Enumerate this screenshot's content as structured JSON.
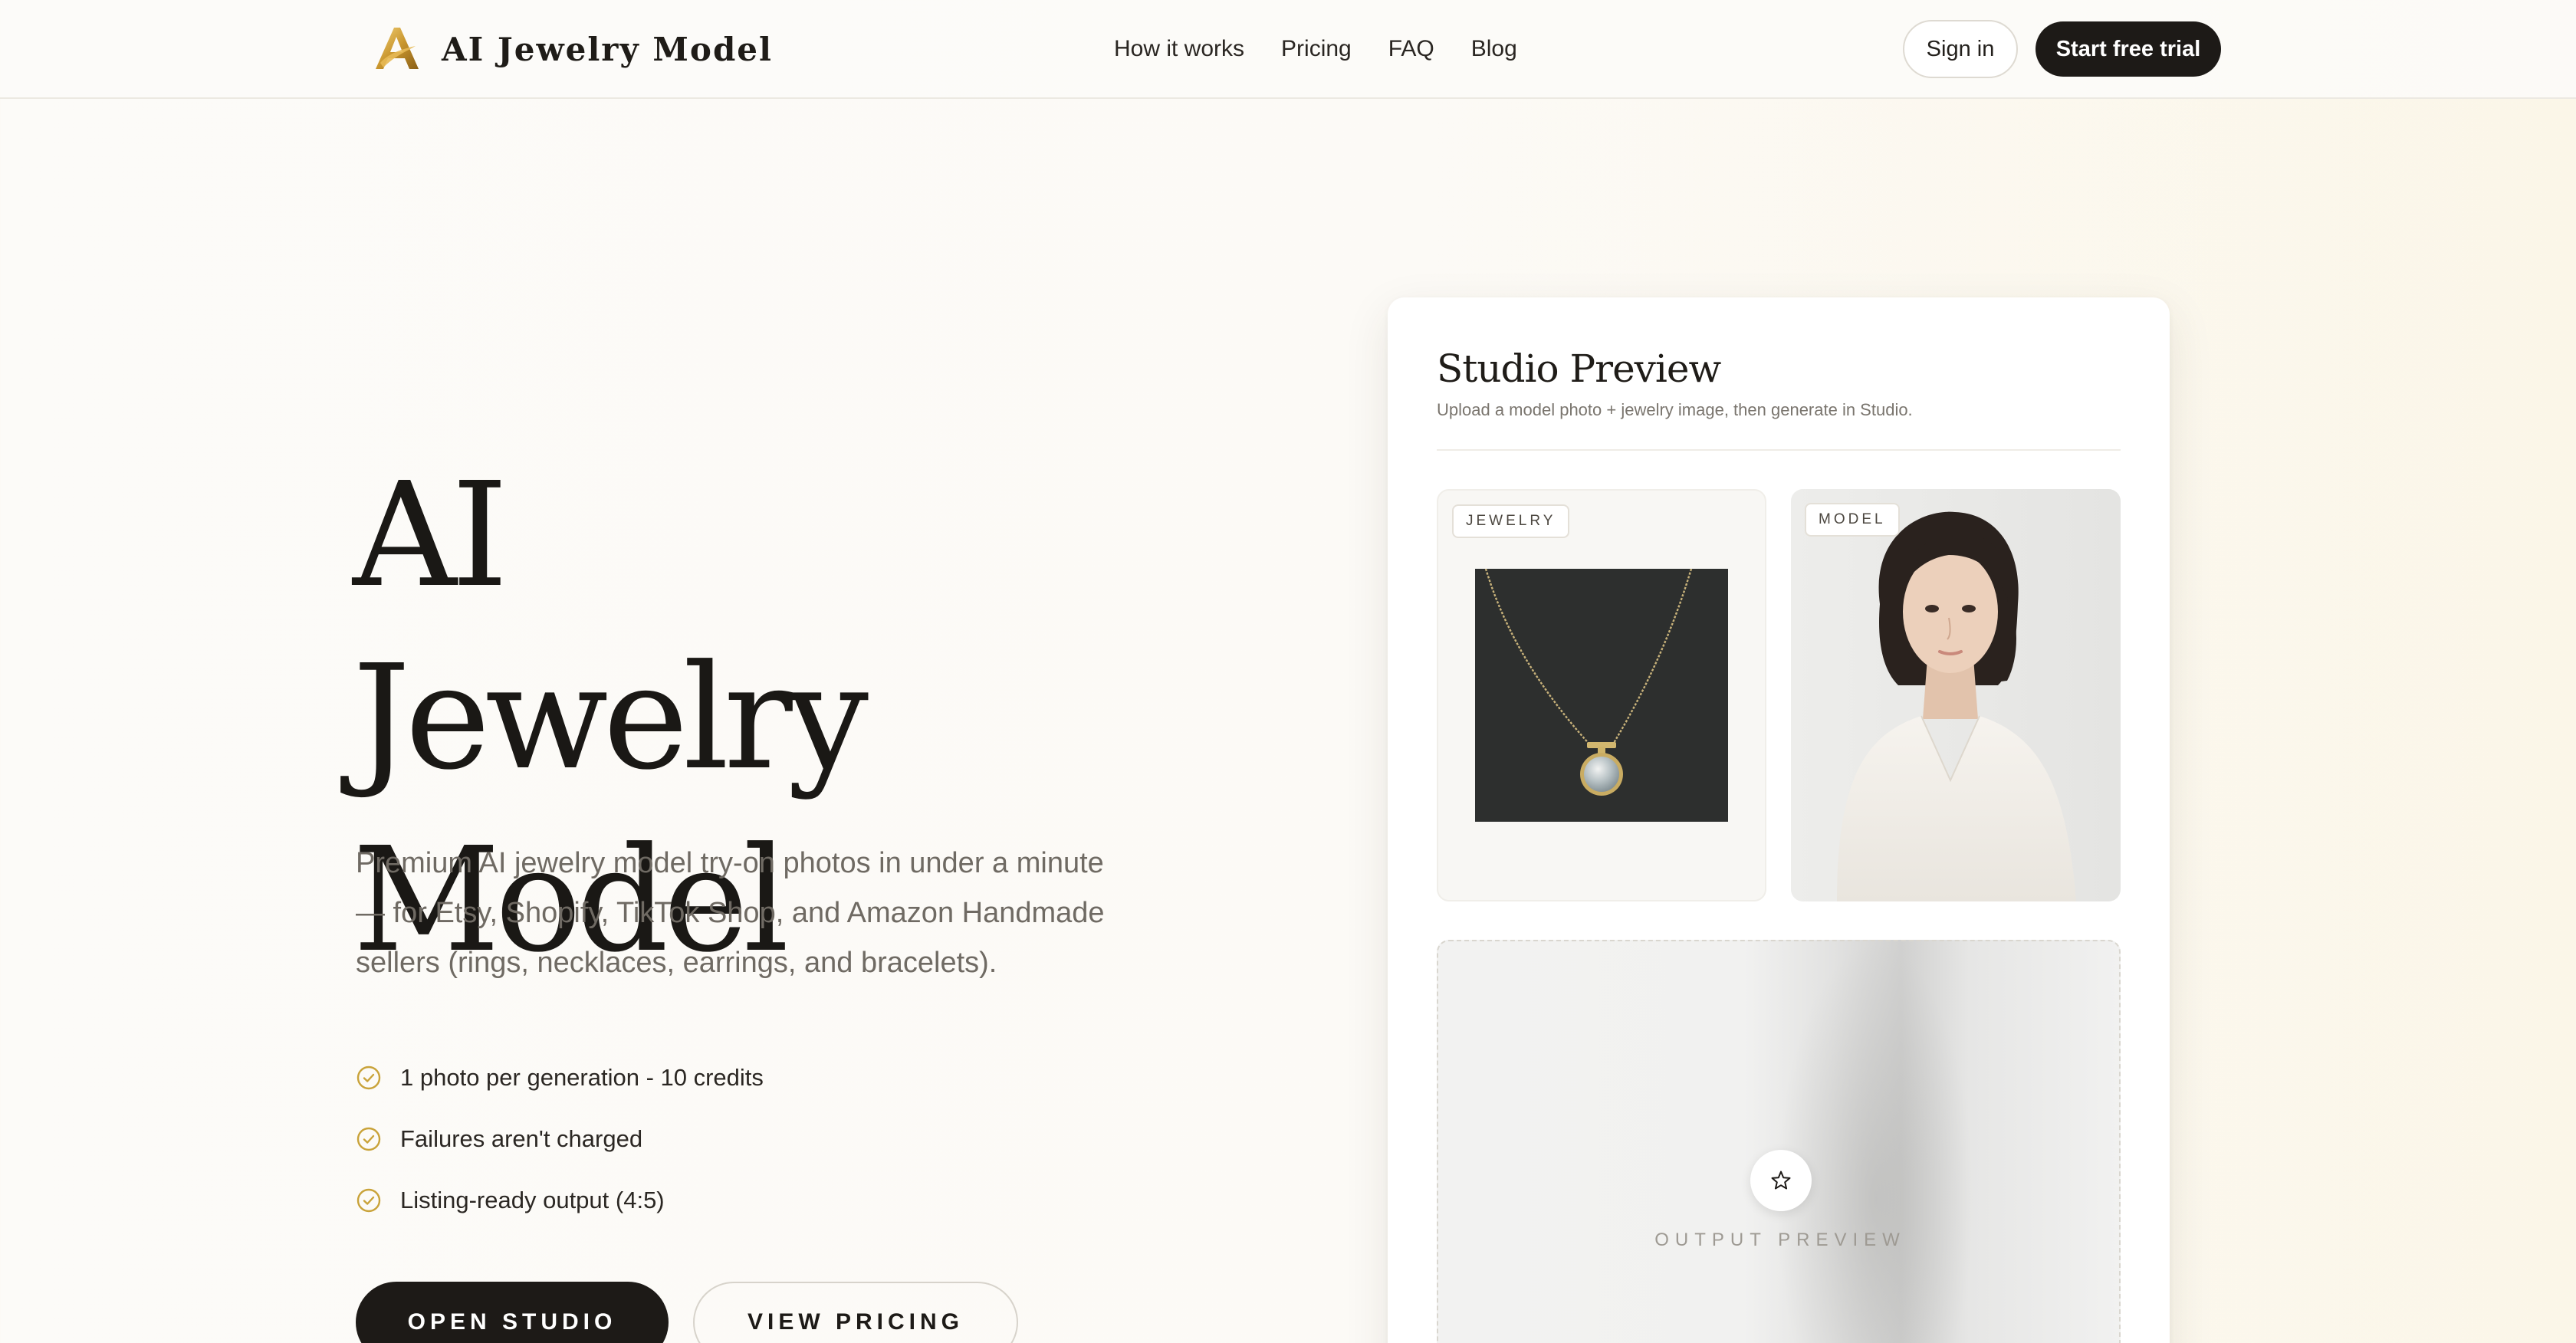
{
  "header": {
    "brand_name": "AI Jewelry Model",
    "logo_icon": "gold-letter-a-logo",
    "nav": [
      {
        "label": "How it works"
      },
      {
        "label": "Pricing"
      },
      {
        "label": "FAQ"
      },
      {
        "label": "Blog"
      }
    ],
    "sign_in_label": "Sign in",
    "trial_label": "Start free trial"
  },
  "hero": {
    "title_line1": "AI Jewelry",
    "title_line2": "Model",
    "subtitle": "Premium AI jewelry model try-on photos in under a minute — for Etsy, Shopify, TikTok Shop, and Amazon Handmade sellers (rings, necklaces, earrings, and bracelets).",
    "features": [
      {
        "text": "1 photo per generation - 10 credits"
      },
      {
        "text": "Failures aren't charged"
      },
      {
        "text": "Listing-ready output (4:5)"
      }
    ],
    "feature_icon": "check-circle-icon",
    "open_studio_label": "OPEN STUDIO",
    "view_pricing_label": "VIEW PRICING"
  },
  "studio": {
    "title": "Studio Preview",
    "subtitle": "Upload a model photo + jewelry image, then generate in Studio.",
    "jewelry_tag": "JEWELRY",
    "model_tag": "MODEL",
    "output_label": "OUTPUT PREVIEW",
    "output_icon": "star-icon"
  },
  "colors": {
    "accent_gold": "#c9a33a",
    "dark": "#1d1a17",
    "background": "#fcfbf8"
  }
}
